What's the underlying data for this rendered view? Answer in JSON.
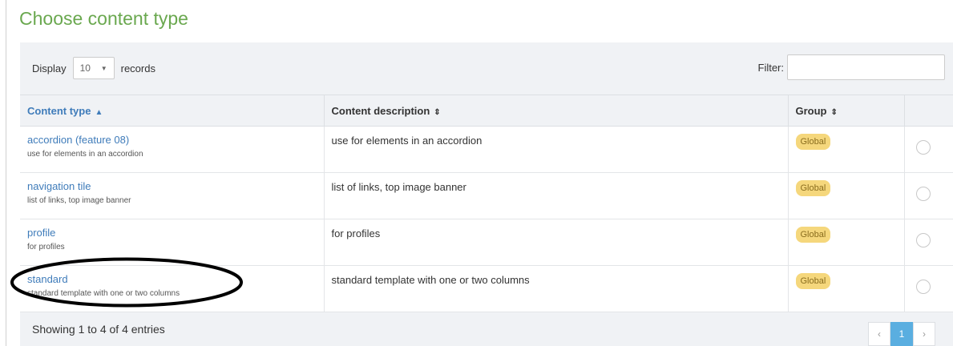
{
  "page": {
    "title": "Choose content type"
  },
  "toolbar": {
    "display_label": "Display",
    "length_value": "10",
    "records_label": "records",
    "filter_label": "Filter:",
    "filter_value": ""
  },
  "table": {
    "columns": [
      {
        "label": "Content type",
        "sort": "ascending"
      },
      {
        "label": "Content description",
        "sort": "sortable"
      },
      {
        "label": "Group",
        "sort": "sortable"
      },
      {
        "label": ""
      }
    ],
    "rows": [
      {
        "name": "accordion (feature 08)",
        "subtitle": "use for elements in an accordion",
        "description": "use for elements in an accordion",
        "group": "Global"
      },
      {
        "name": "navigation tile",
        "subtitle": "list of links, top image banner",
        "description": "list of links, top image banner",
        "group": "Global"
      },
      {
        "name": "profile",
        "subtitle": "for profiles",
        "description": "for profiles",
        "group": "Global"
      },
      {
        "name": "standard",
        "subtitle": "standard template with one or two columns",
        "description": "standard template with one or two columns",
        "group": "Global"
      }
    ]
  },
  "footer": {
    "info": "Showing 1 to 4 of 4 entries",
    "pager": {
      "prev": "‹",
      "current": "1",
      "next": "›"
    }
  },
  "icons": {
    "sort_asc": "caret-up-icon",
    "sort_both": "sort-icon",
    "select": "radio-icon",
    "dropdown": "chevron-down-icon"
  },
  "colors": {
    "title": "#6aa84f",
    "link": "#3f7cba",
    "badge": "#f5d77c",
    "pager_active": "#5aaee0"
  }
}
